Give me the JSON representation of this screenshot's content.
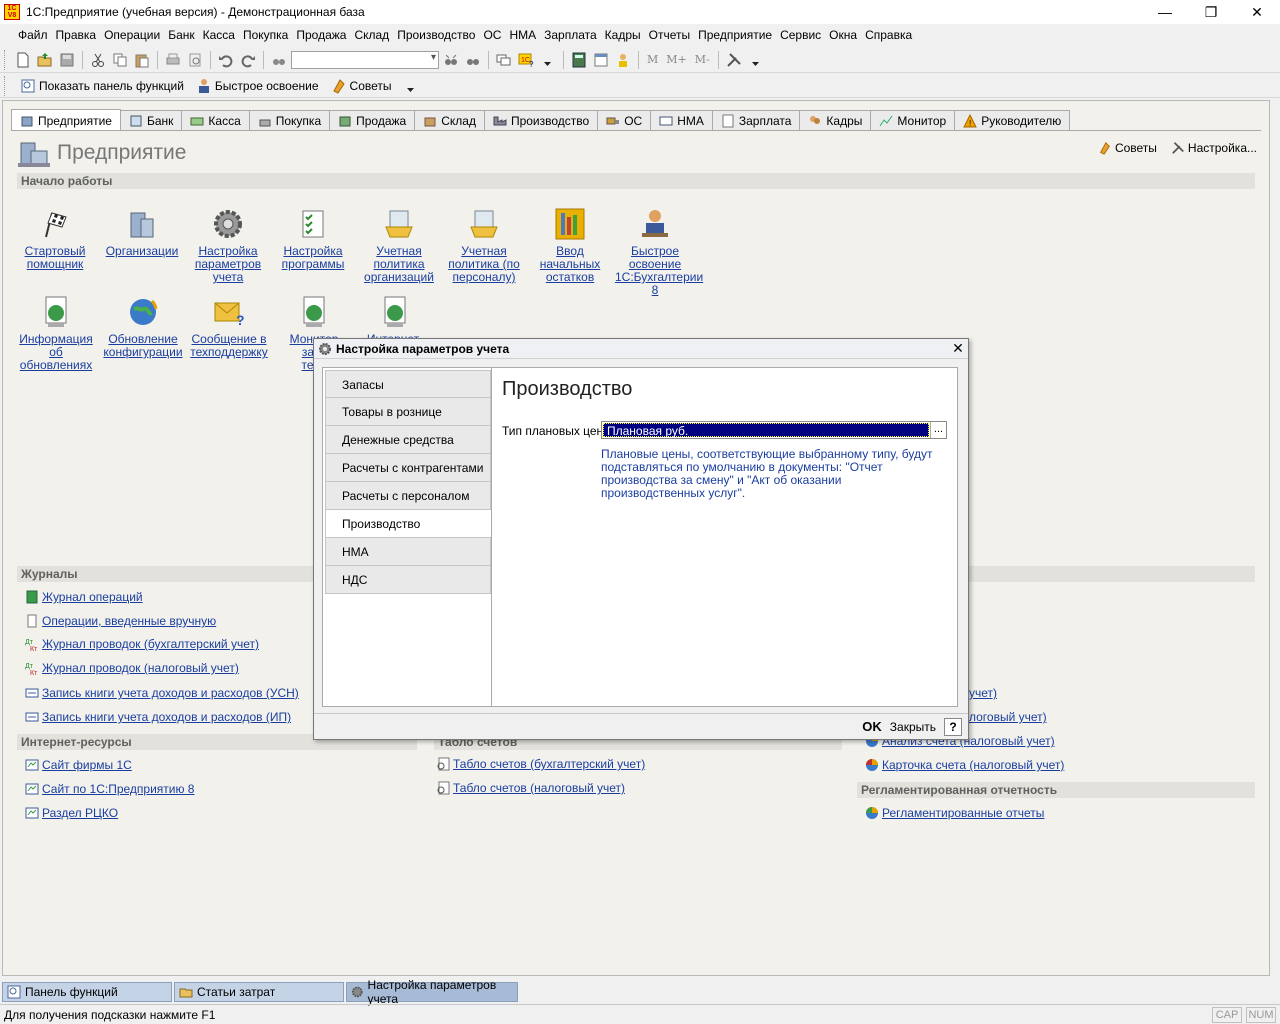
{
  "window": {
    "title": "1С:Предприятие (учебная версия) - Демонстрационная база",
    "app_icon_text": "1C V8",
    "minimize": "—",
    "restore": "❐",
    "close": "✕"
  },
  "menu": [
    "Файл",
    "Правка",
    "Операции",
    "Банк",
    "Касса",
    "Покупка",
    "Продажа",
    "Склад",
    "Производство",
    "ОС",
    "НМА",
    "Зарплата",
    "Кадры",
    "Отчеты",
    "Предприятие",
    "Сервис",
    "Окна",
    "Справка"
  ],
  "toolbar2": {
    "show_panel": "Показать панель функций",
    "quick_learn": "Быстрое освоение",
    "tips": "Советы"
  },
  "tabs": [
    "Предприятие",
    "Банк",
    "Касса",
    "Покупка",
    "Продажа",
    "Склад",
    "Производство",
    "ОС",
    "НМА",
    "Зарплата",
    "Кадры",
    "Монитор",
    "Руководителю"
  ],
  "page": {
    "title": "Предприятие",
    "tips": "Советы",
    "settings": "Настройка..."
  },
  "sections": {
    "start": "Начало работы",
    "journals": "Журналы",
    "internet": "Интернет-ресурсы",
    "accounts_table": "Табло счетов",
    "reg_reports": "Регламентированная отчетность"
  },
  "start_row1": [
    {
      "l1": "Стартовый",
      "l2": "помощник",
      "l3": ""
    },
    {
      "l1": "Организации",
      "l2": "",
      "l3": ""
    },
    {
      "l1": "Настройка",
      "l2": "параметров",
      "l3": "учета"
    },
    {
      "l1": "Настройка",
      "l2": "программы",
      "l3": ""
    },
    {
      "l1": "Учетная",
      "l2": "политика",
      "l3": "организаций"
    },
    {
      "l1": "Учетная",
      "l2": "политика (по",
      "l3": "персоналу)"
    },
    {
      "l1": "Ввод",
      "l2": "начальных",
      "l3": "остатков"
    },
    {
      "l1": "Быстрое",
      "l2": "освоение",
      "l3": "1С:Бухгалтерии 8"
    }
  ],
  "start_row2": [
    {
      "l1": "Информация",
      "l2": "об",
      "l3": "обновлениях"
    },
    {
      "l1": "Обновление",
      "l2": "конфигурации",
      "l3": ""
    },
    {
      "l1": "Сообщение в",
      "l2": "техподдержку",
      "l3": ""
    },
    {
      "l1": "Монитор",
      "l2": "зако",
      "l3": "тель"
    },
    {
      "l1": "Интернет-ресурс",
      "l2": "",
      "l3": ""
    }
  ],
  "journals": [
    "Журнал операций",
    "Операции, введенные вручную",
    "Журнал проводок (бухгалтерский учет)",
    "Журнал проводок (налоговый учет)",
    "Запись книги учета доходов и расходов (УСН)",
    "Запись книги учета доходов и расходов (ИП)"
  ],
  "internet": [
    "Сайт фирмы 1С",
    "Сайт по 1С:Предприятию 8",
    "Раздел РЦКО"
  ],
  "accounts_links": [
    "Табло счетов (бухгалтерский учет)",
    "Табло счетов (налоговый учет)"
  ],
  "right_col": {
    "r1": "учет)",
    "r2": "логовый учет)",
    "r3": "Анализ счета (налоговый учет)",
    "r4": "Карточка счета (налоговый учет)",
    "reg": "Регламентированные отчеты"
  },
  "taskbar": [
    "Панель функций",
    "Статьи затрат",
    "Настройка параметров учета"
  ],
  "status": {
    "hint": "Для получения подсказки нажмите F1",
    "cap": "CAP",
    "num": "NUM"
  },
  "dialog": {
    "title": "Настройка параметров учета",
    "nav": [
      "Запасы",
      "Товары в рознице",
      "Денежные средства",
      "Расчеты с контрагентами",
      "Расчеты с персоналом",
      "Производство",
      "НМА",
      "НДС"
    ],
    "active_index": 5,
    "heading": "Производство",
    "field_label": "Тип плановых цен:",
    "field_value": "Плановая руб.",
    "select_btn": "...",
    "hint": "Плановые цены, соответствующие выбранному типу, будут подставляться по умолчанию в документы: \"Отчет производства за смену\" и \"Акт об оказании производственных услуг\".",
    "ok": "OK",
    "close": "Закрыть",
    "help": "?"
  }
}
